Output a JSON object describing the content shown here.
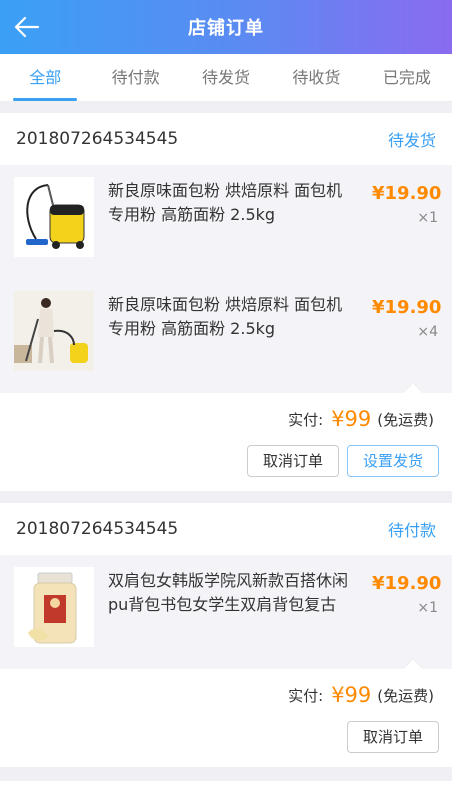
{
  "header": {
    "title": "店铺订单",
    "back_icon": "arrow-left-icon"
  },
  "tabs": [
    {
      "label": "全部",
      "active": true
    },
    {
      "label": "待付款",
      "active": false
    },
    {
      "label": "待发货",
      "active": false
    },
    {
      "label": "待收货",
      "active": false
    },
    {
      "label": "已完成",
      "active": false
    }
  ],
  "orders": [
    {
      "order_no": "201807264534545",
      "status": "待发货",
      "items": [
        {
          "title": "新良原味面包粉 烘焙原料 面包机专用粉 高筋面粉 2.5kg",
          "price": "¥19.90",
          "qty": "×1",
          "thumb": "vacuum-cleaner-image"
        },
        {
          "title": "新良原味面包粉 烘焙原料 面包机专用粉 高筋面粉 2.5kg",
          "price": "¥19.90",
          "qty": "×4",
          "thumb": "woman-vacuuming-image"
        }
      ],
      "total_label": "实付:",
      "total_amount": "¥99",
      "shipping_note": "(免运费)",
      "buttons": [
        "取消订单",
        "设置发货"
      ]
    },
    {
      "order_no": "201807264534545",
      "status": "待付款",
      "items": [
        {
          "title": "双肩包女韩版学院风新款百搭休闲pu背包书包女学生双肩背包复古",
          "price": "¥19.90",
          "qty": "×1",
          "thumb": "food-jar-image"
        }
      ],
      "total_label": "实付:",
      "total_amount": "¥99",
      "shipping_note": "(免运费)",
      "buttons": [
        "取消订单"
      ]
    }
  ],
  "colors": {
    "accent": "#3aa0f5",
    "price": "#ff8a00",
    "header_end": "#8a6bf0"
  }
}
